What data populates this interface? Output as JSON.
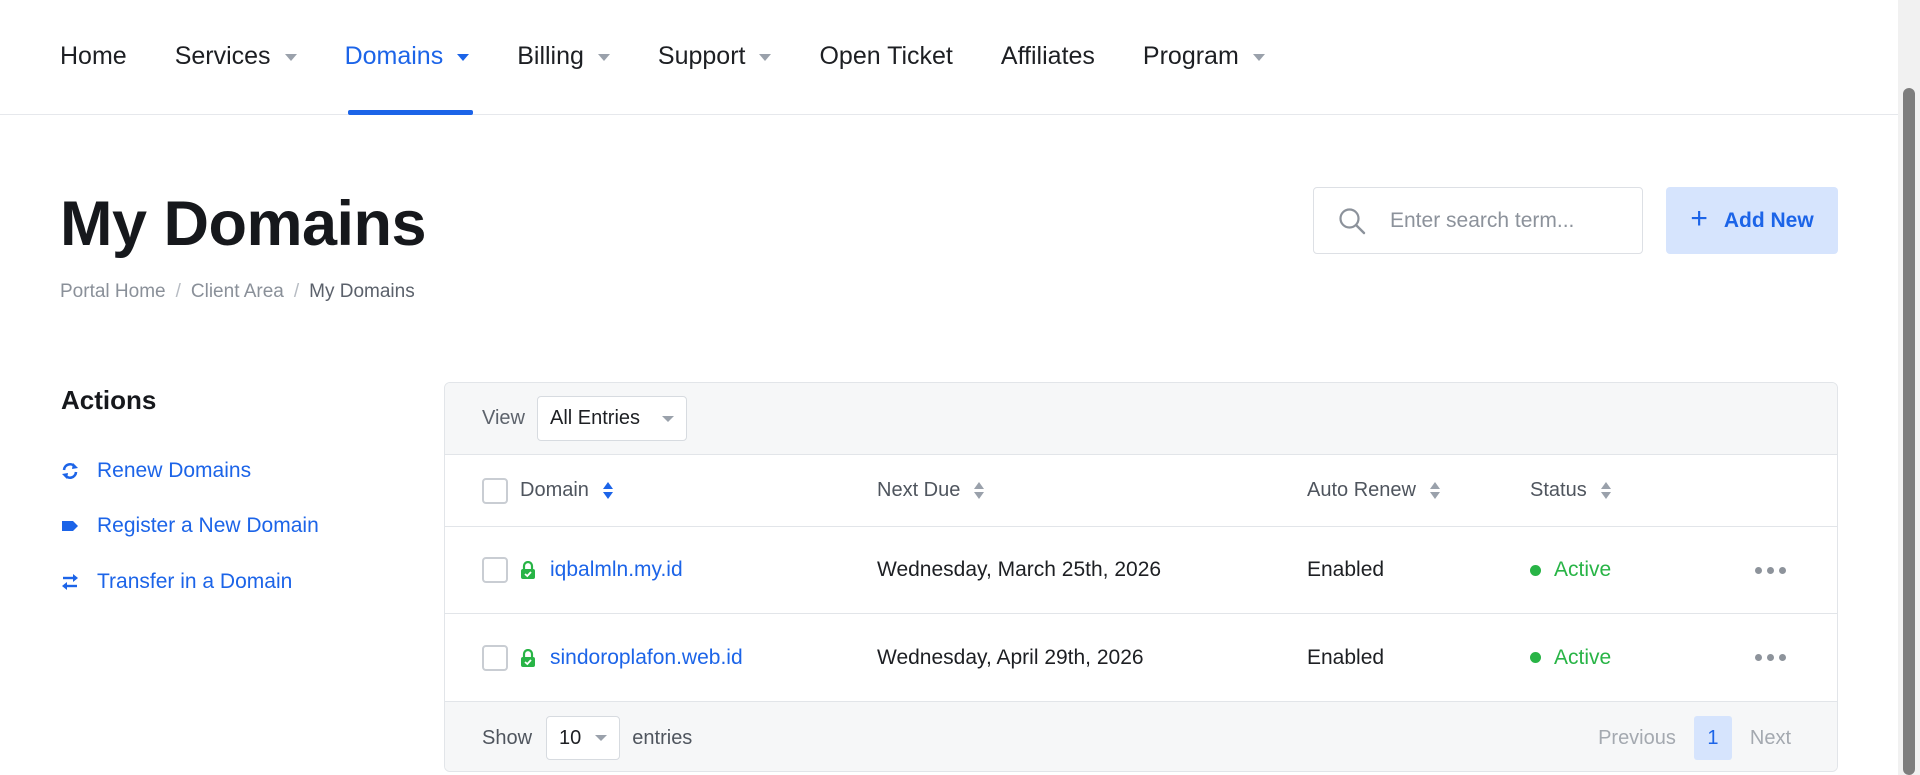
{
  "nav": {
    "items": [
      {
        "label": "Home",
        "dropdown": false,
        "active": false
      },
      {
        "label": "Services",
        "dropdown": true,
        "active": false
      },
      {
        "label": "Domains",
        "dropdown": true,
        "active": true
      },
      {
        "label": "Billing",
        "dropdown": true,
        "active": false
      },
      {
        "label": "Support",
        "dropdown": true,
        "active": false
      },
      {
        "label": "Open Ticket",
        "dropdown": false,
        "active": false
      },
      {
        "label": "Affiliates",
        "dropdown": false,
        "active": false
      },
      {
        "label": "Program",
        "dropdown": true,
        "active": false
      }
    ]
  },
  "header": {
    "title": "My Domains",
    "breadcrumb": [
      "Portal Home",
      "Client Area",
      "My Domains"
    ],
    "search_placeholder": "Enter search term...",
    "add_label": "Add New"
  },
  "sidebar": {
    "title": "Actions",
    "links": [
      {
        "label": "Renew Domains",
        "icon": "sync-icon"
      },
      {
        "label": "Register a New Domain",
        "icon": "tag-icon"
      },
      {
        "label": "Transfer in a Domain",
        "icon": "exchange-icon"
      }
    ]
  },
  "table": {
    "view_label": "View",
    "view_selected": "All Entries",
    "columns": [
      "Domain",
      "Next Due",
      "Auto Renew",
      "Status"
    ],
    "rows": [
      {
        "domain": "iqbalmln.my.id",
        "next_due": "Wednesday, March 25th, 2026",
        "auto_renew": "Enabled",
        "status": "Active"
      },
      {
        "domain": "sindoroplafon.web.id",
        "next_due": "Wednesday, April 29th, 2026",
        "auto_renew": "Enabled",
        "status": "Active"
      }
    ],
    "show_label": "Show",
    "page_size": "10",
    "entries_label": "entries",
    "prev_label": "Previous",
    "current_page": "1",
    "next_label": "Next"
  },
  "colors": {
    "accent": "#1c64e8",
    "accent_light": "#d6e4fd",
    "status_active": "#28b446"
  }
}
